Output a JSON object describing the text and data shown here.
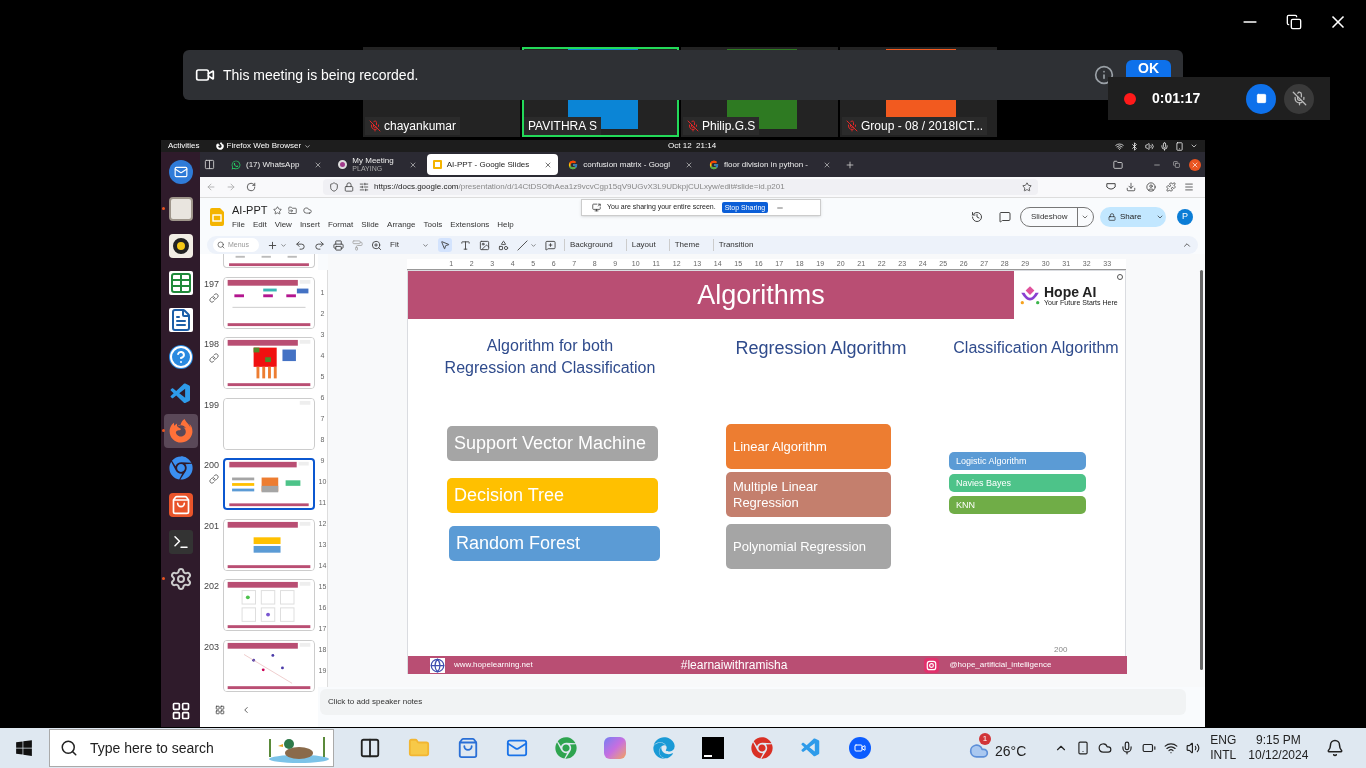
{
  "zoom": {
    "recording_notice": {
      "text": "This meeting is being recorded.",
      "button": "OK"
    },
    "participants": [
      {
        "name": "chayankumar",
        "muted": true,
        "selected": false
      },
      {
        "name": "PAVITHRA S",
        "muted": false,
        "selected": true,
        "color": "#0b85d6"
      },
      {
        "name": "Philip.G.S",
        "muted": true,
        "selected": false,
        "color": "#2e7a22"
      },
      {
        "name": "Group - 08 / 2018ICT...",
        "muted": true,
        "selected": false,
        "color": "#f25a1f"
      }
    ],
    "recording_time": "0:01:17"
  },
  "desktop": {
    "activities": "Activities",
    "app_menu": "Firefox Web Browser",
    "clock": "Oct 12  21:14",
    "dock": [
      {
        "kind": "mail",
        "running": false,
        "selected": false
      },
      {
        "kind": "files",
        "running": true,
        "selected": false
      },
      {
        "kind": "music",
        "running": false,
        "selected": false
      },
      {
        "kind": "sheet",
        "running": false,
        "selected": false
      },
      {
        "kind": "doc",
        "running": false,
        "selected": false
      },
      {
        "kind": "help",
        "running": false,
        "selected": false
      },
      {
        "kind": "code",
        "running": false,
        "selected": false
      },
      {
        "kind": "fox",
        "running": true,
        "selected": true
      },
      {
        "kind": "chrome",
        "running": false,
        "selected": false
      },
      {
        "kind": "store",
        "running": false,
        "selected": false
      },
      {
        "kind": "terminal",
        "running": false,
        "selected": false
      },
      {
        "kind": "settings",
        "running": true,
        "selected": false
      }
    ]
  },
  "browser": {
    "tabs": [
      {
        "label": "(17) WhatsApp",
        "kind": "chat",
        "selected": false
      },
      {
        "label": "My Meeting",
        "sublabel": "PLAYING",
        "kind": "meeting",
        "selected": false
      },
      {
        "label": "AI-PPT - Google Slides",
        "kind": "slides",
        "selected": true
      },
      {
        "label": "confusion matrix - Googl",
        "kind": "search",
        "selected": false
      },
      {
        "label": "floor division in python -",
        "kind": "search",
        "selected": false
      }
    ],
    "url_host": "https://docs.google.com",
    "url_path": "/presentation/d/14CtDSOthAea1z9vcvCgp15qV9UGvX3L9UDkpjCULxyw/edit#slide=id.p201",
    "sharing_bar": {
      "text": "You are sharing your entire screen.",
      "button": "Stop Sharing"
    }
  },
  "slides_app": {
    "title": "AI-PPT",
    "menus": [
      "File",
      "Edit",
      "View",
      "Insert",
      "Format",
      "Slide",
      "Arrange",
      "Tools",
      "Extensions",
      "Help"
    ],
    "search_placeholder": "Menus",
    "zoom": "Fit",
    "toolbar_buttons": [
      "Background",
      "Layout",
      "Theme",
      "Transition"
    ],
    "slideshow": "Slideshow",
    "share": "Share",
    "avatar": "P",
    "filmstrip": [
      {
        "number": "197",
        "linked": true,
        "selected": false,
        "kind": "diagram"
      },
      {
        "number": "198",
        "linked": true,
        "selected": false,
        "kind": "matrix"
      },
      {
        "number": "199",
        "linked": false,
        "selected": false,
        "kind": "blank"
      },
      {
        "number": "200",
        "linked": true,
        "selected": true,
        "kind": "algorithms"
      },
      {
        "number": "201",
        "linked": false,
        "selected": false,
        "kind": "buttons"
      },
      {
        "number": "202",
        "linked": false,
        "selected": false,
        "kind": "plots"
      },
      {
        "number": "203",
        "linked": false,
        "selected": false,
        "kind": "scatter"
      }
    ],
    "ruler": {
      "horizontal": [
        "1",
        "2",
        "3",
        "4",
        "5",
        "6",
        "7",
        "8",
        "9",
        "10",
        "11",
        "12",
        "13",
        "14",
        "15",
        "16",
        "17",
        "18",
        "19",
        "20",
        "21",
        "22",
        "23",
        "24",
        "25",
        "26",
        "27",
        "28",
        "29",
        "30",
        "31",
        "32",
        "33"
      ],
      "vertical": [
        "1",
        "2",
        "3",
        "4",
        "5",
        "6",
        "7",
        "8",
        "9",
        "10",
        "11",
        "12",
        "13",
        "14",
        "15",
        "16",
        "17",
        "18",
        "19"
      ]
    },
    "slide": {
      "title": "Algorithms",
      "logo": {
        "name": "Hope AI",
        "tagline": "Your Future Starts Here"
      },
      "columns": [
        {
          "heading": "Algorithm for both\nRegression and Classification",
          "items": [
            {
              "label": "Support Vector Machine",
              "color": "#a5a5a5"
            },
            {
              "label": "Decision Tree",
              "color": "#ffc000"
            },
            {
              "label": "Random Forest",
              "color": "#5b9bd5"
            }
          ]
        },
        {
          "heading": "Regression Algorithm",
          "items": [
            {
              "label": "Linear Algorithm",
              "color": "#ed7d31"
            },
            {
              "label": "Multiple Linear Regression",
              "color": "#c47f6d"
            },
            {
              "label": "Polynomial Regression",
              "color": "#a5a5a5"
            }
          ]
        },
        {
          "heading": "Classification Algorithm",
          "items": [
            {
              "label": "Logistic Algorithm",
              "color": "#5b9bd5"
            },
            {
              "label": "Navies Bayes",
              "color": "#4dc389"
            },
            {
              "label": "KNN",
              "color": "#70ad47"
            }
          ]
        }
      ],
      "page_number": "200",
      "footer": {
        "website": "www.hopelearning.net",
        "hashtag": "#learnaiwithramisha",
        "handle": "@hope_artificial_intelligence"
      }
    },
    "speaker_notes_placeholder": "Click to add speaker notes"
  },
  "taskbar": {
    "search_placeholder": "Type here to search",
    "weather": "26°C",
    "weather_badge": "1",
    "language": "ENG",
    "layout": "INTL",
    "time": "9:15 PM",
    "date": "10/12/2024",
    "apps": [
      {
        "kind": "taskview"
      },
      {
        "kind": "folder"
      },
      {
        "kind": "store"
      },
      {
        "kind": "mail"
      },
      {
        "kind": "chrome-profile"
      },
      {
        "kind": "copilot"
      },
      {
        "kind": "edge"
      },
      {
        "kind": "ide"
      },
      {
        "kind": "chrome"
      },
      {
        "kind": "code"
      },
      {
        "kind": "meet"
      }
    ]
  }
}
